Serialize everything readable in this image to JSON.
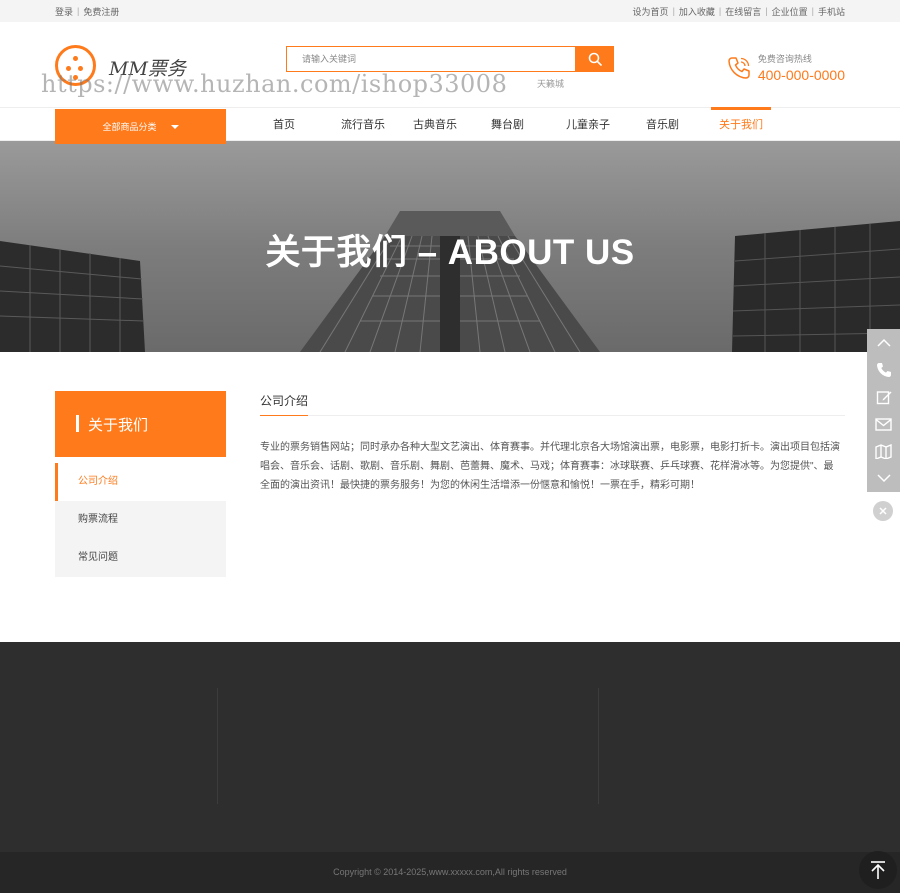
{
  "topbar": {
    "left_links": [
      "登录",
      "免费注册"
    ],
    "right_links": [
      "设为首页",
      "加入收藏",
      "在线留言",
      "企业位置",
      "手机站"
    ]
  },
  "header": {
    "logo_text": "MM票务",
    "watermark": "https://www.huzhan.com/ishop33008",
    "search_placeholder": "请输入关键词",
    "hot_words": [
      "",
      "",
      "",
      "",
      "天籁城"
    ],
    "hotline_label": "免费咨询热线",
    "hotline_number": "400-000-0000"
  },
  "nav": {
    "category_label": "全部商品分类",
    "items": [
      "首页",
      "流行音乐",
      "古典音乐",
      "舞台剧",
      "儿童亲子",
      "音乐剧",
      "关于我们"
    ],
    "active_index": 6
  },
  "banner": {
    "title": "关于我们 – ABOUT US"
  },
  "sidebar": {
    "title": "关于我们",
    "items": [
      "公司介绍",
      "购票流程",
      "常见问题"
    ],
    "active_index": 0
  },
  "main": {
    "heading": "公司介绍",
    "body": "专业的票务销售网站；同时承办各种大型文艺演出、体育赛事。并代理北京各大场馆演出票，电影票，电影打折卡。演出项目包括演唱会、音乐会、话剧、歌剧、音乐剧、舞剧、芭蕾舞、魔术、马戏；体育赛事：冰球联赛、乒乓球赛、花样滑冰等。为您提供\"、最全面的演出资讯！最快捷的票务服务！为您的休闲生活增添一份惬意和愉悦！一票在手，精彩可期！"
  },
  "footer": {
    "copyright": "Copyright © 2014-2025,www.xxxxx.com,All rights reserved"
  },
  "floatbar": {
    "icons": [
      "chevron-up-icon",
      "phone-icon",
      "edit-icon",
      "mail-icon",
      "map-icon",
      "chevron-down-icon"
    ]
  },
  "colors": {
    "accent": "#ff7a1a",
    "footer": "#2e2e2e",
    "bottom": "#262626"
  }
}
